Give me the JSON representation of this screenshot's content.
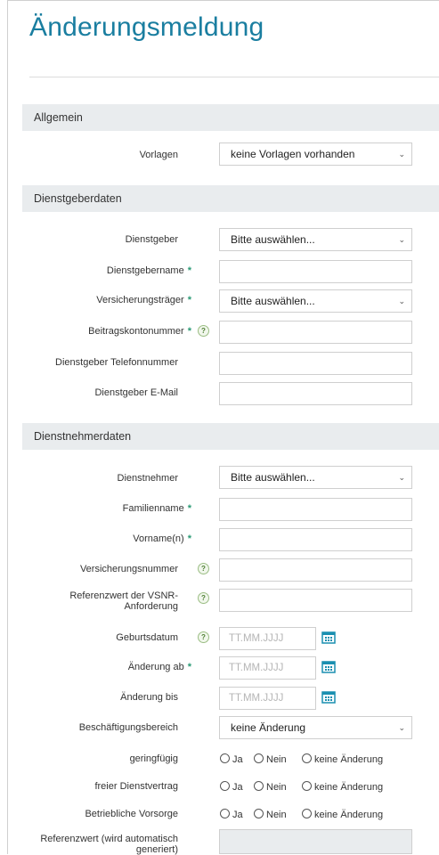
{
  "page": {
    "title": "Änderungsmeldung"
  },
  "sections": {
    "allgemein": "Allgemein",
    "dienstgeber": "Dienstgeberdaten",
    "dienstnehmer": "Dienstnehmerdaten"
  },
  "allgemein": {
    "vorlagen_label": "Vorlagen",
    "vorlagen_value": "keine Vorlagen vorhanden"
  },
  "dienstgeber": {
    "dienstgeber_label": "Dienstgeber",
    "dienstgeber_value": "Bitte auswählen...",
    "dienstgebername_label": "Dienstgebername",
    "versicherungstraeger_label": "Versicherungsträger",
    "versicherungstraeger_value": "Bitte auswählen...",
    "beitragskontonummer_label": "Beitragskontonummer",
    "telefon_label": "Dienstgeber Telefonnummer",
    "email_label": "Dienstgeber E-Mail"
  },
  "dienstnehmer": {
    "dienstnehmer_label": "Dienstnehmer",
    "dienstnehmer_value": "Bitte auswählen...",
    "familienname_label": "Familienname",
    "vorname_label": "Vorname(n)",
    "versicherungsnummer_label": "Versicherungsnummer",
    "referenzwert_vsnr_label_1": "Referenzwert der VSNR-",
    "referenzwert_vsnr_label_2": "Anforderung",
    "geburtsdatum_label": "Geburtsdatum",
    "aenderung_ab_label": "Änderung ab",
    "aenderung_bis_label": "Änderung bis",
    "date_placeholder": "TT.MM.JJJJ",
    "beschaeftigungsbereich_label": "Beschäftigungsbereich",
    "beschaeftigungsbereich_value": "keine Änderung",
    "geringfuegig_label": "geringfügig",
    "freier_dv_label": "freier Dienstvertrag",
    "betriebliche_vorsorge_label": "Betriebliche Vorsorge",
    "referenzwert_auto_label_1": "Referenzwert (wird automatisch",
    "referenzwert_auto_label_2": "generiert)"
  },
  "common": {
    "required_marker": "*",
    "help_icon": "?",
    "chevron": "⌄",
    "radio_ja": "Ja",
    "radio_nein": "Nein",
    "radio_keine": "keine Änderung"
  },
  "colors": {
    "title": "#1a7ea0",
    "section_bg": "#e9ecee",
    "required": "#2a9a75",
    "calendar": "#1a8fb0"
  },
  "icons": {
    "help": "help-icon",
    "calendar": "calendar-icon",
    "dropdown": "chevron-down-icon"
  }
}
